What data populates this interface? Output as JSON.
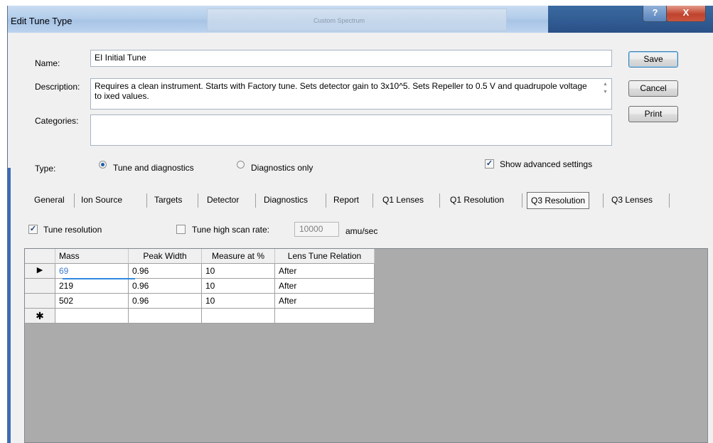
{
  "window": {
    "title": "Edit Tune Type",
    "background_window_text": "Custom Spectrum",
    "help_glyph": "?",
    "close_glyph": "X"
  },
  "form": {
    "name_label": "Name:",
    "name_value": "EI Initial Tune",
    "description_label": "Description:",
    "description_value": "Requires a clean instrument. Starts with Factory tune. Sets detector gain to 3x10^5. Sets Repeller to 0.5 V and quadrupole voltage to ixed values.",
    "categories_label": "Categories:",
    "categories_value": "",
    "type_label": "Type:",
    "type_options": [
      {
        "label": "Tune and diagnostics",
        "selected": true
      },
      {
        "label": "Diagnostics only",
        "selected": false
      }
    ],
    "show_advanced_label": "Show advanced settings",
    "show_advanced_checked": true
  },
  "buttons": {
    "save": "Save",
    "cancel": "Cancel",
    "print": "Print"
  },
  "tabs": [
    {
      "label": "General",
      "active": false
    },
    {
      "label": "Ion Source",
      "active": false
    },
    {
      "label": "Targets",
      "active": false
    },
    {
      "label": "Detector",
      "active": false
    },
    {
      "label": "Diagnostics",
      "active": false
    },
    {
      "label": "Report",
      "active": false
    },
    {
      "label": "Q1 Lenses",
      "active": false
    },
    {
      "label": "Q1 Resolution",
      "active": false
    },
    {
      "label": "Q3 Resolution",
      "active": true
    },
    {
      "label": "Q3 Lenses",
      "active": false
    }
  ],
  "resolution": {
    "tune_resolution_label": "Tune resolution",
    "tune_resolution_checked": true,
    "tune_high_scan_label": "Tune high scan rate:",
    "tune_high_scan_checked": false,
    "scan_rate_value": "10000",
    "scan_rate_unit": "amu/sec"
  },
  "grid": {
    "columns": [
      "Mass",
      "Peak Width",
      "Measure at %",
      "Lens Tune Relation"
    ],
    "rows": [
      [
        "69",
        "0.96",
        "10",
        "After"
      ],
      [
        "219",
        "0.96",
        "10",
        "After"
      ],
      [
        "502",
        "0.96",
        "10",
        "After"
      ]
    ],
    "current_row_glyph": "▶",
    "new_row_glyph": "✱"
  }
}
